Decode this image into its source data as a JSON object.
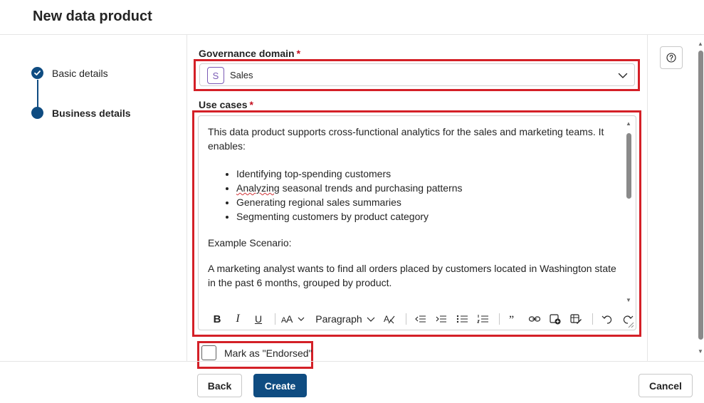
{
  "header": {
    "title": "New data product"
  },
  "stepper": {
    "steps": [
      {
        "label": "Basic details",
        "state": "completed"
      },
      {
        "label": "Business details",
        "state": "current"
      }
    ]
  },
  "governance": {
    "label": "Governance domain",
    "required_mark": "*",
    "selected_chip": "S",
    "selected_value": "Sales"
  },
  "use_cases": {
    "label": "Use cases",
    "required_mark": "*",
    "intro": "This data product supports cross-functional analytics for the sales and marketing teams. It enables:",
    "bullets": [
      "Identifying top-spending customers",
      "Analyzing",
      " seasonal trends and purchasing patterns",
      "Generating regional sales summaries",
      "Segmenting customers by product category"
    ],
    "scenario_heading": "Example Scenario:",
    "scenario_text": "A marketing analyst wants to find all orders placed by customers located in Washington state in the past 6 months, grouped by product."
  },
  "toolbar": {
    "bold": "B",
    "italic": "I",
    "underline": "U",
    "paragraph": "Paragraph"
  },
  "endorse": {
    "label": "Mark as \"Endorsed\"",
    "checked": false
  },
  "footer": {
    "back": "Back",
    "create": "Create",
    "cancel": "Cancel"
  },
  "colors": {
    "primary": "#0f4c81",
    "highlight": "#d42027",
    "required": "#c50f1f",
    "domain_chip": "#7a5ab5"
  }
}
